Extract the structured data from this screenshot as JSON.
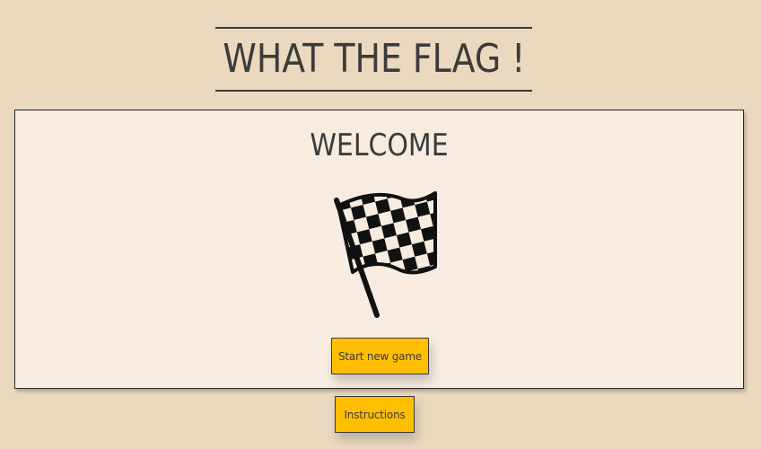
{
  "header": {
    "title": "WHAT THE FLAG !"
  },
  "welcome_panel": {
    "heading": "WELCOME",
    "image": "checkered-flag-icon",
    "start_button_label": "Start new game"
  },
  "instructions_button_label": "Instructions",
  "colors": {
    "background": "#ead9bf",
    "panel": "#f7ecdf",
    "button": "#ffbf00",
    "text": "#3b3b3b"
  }
}
